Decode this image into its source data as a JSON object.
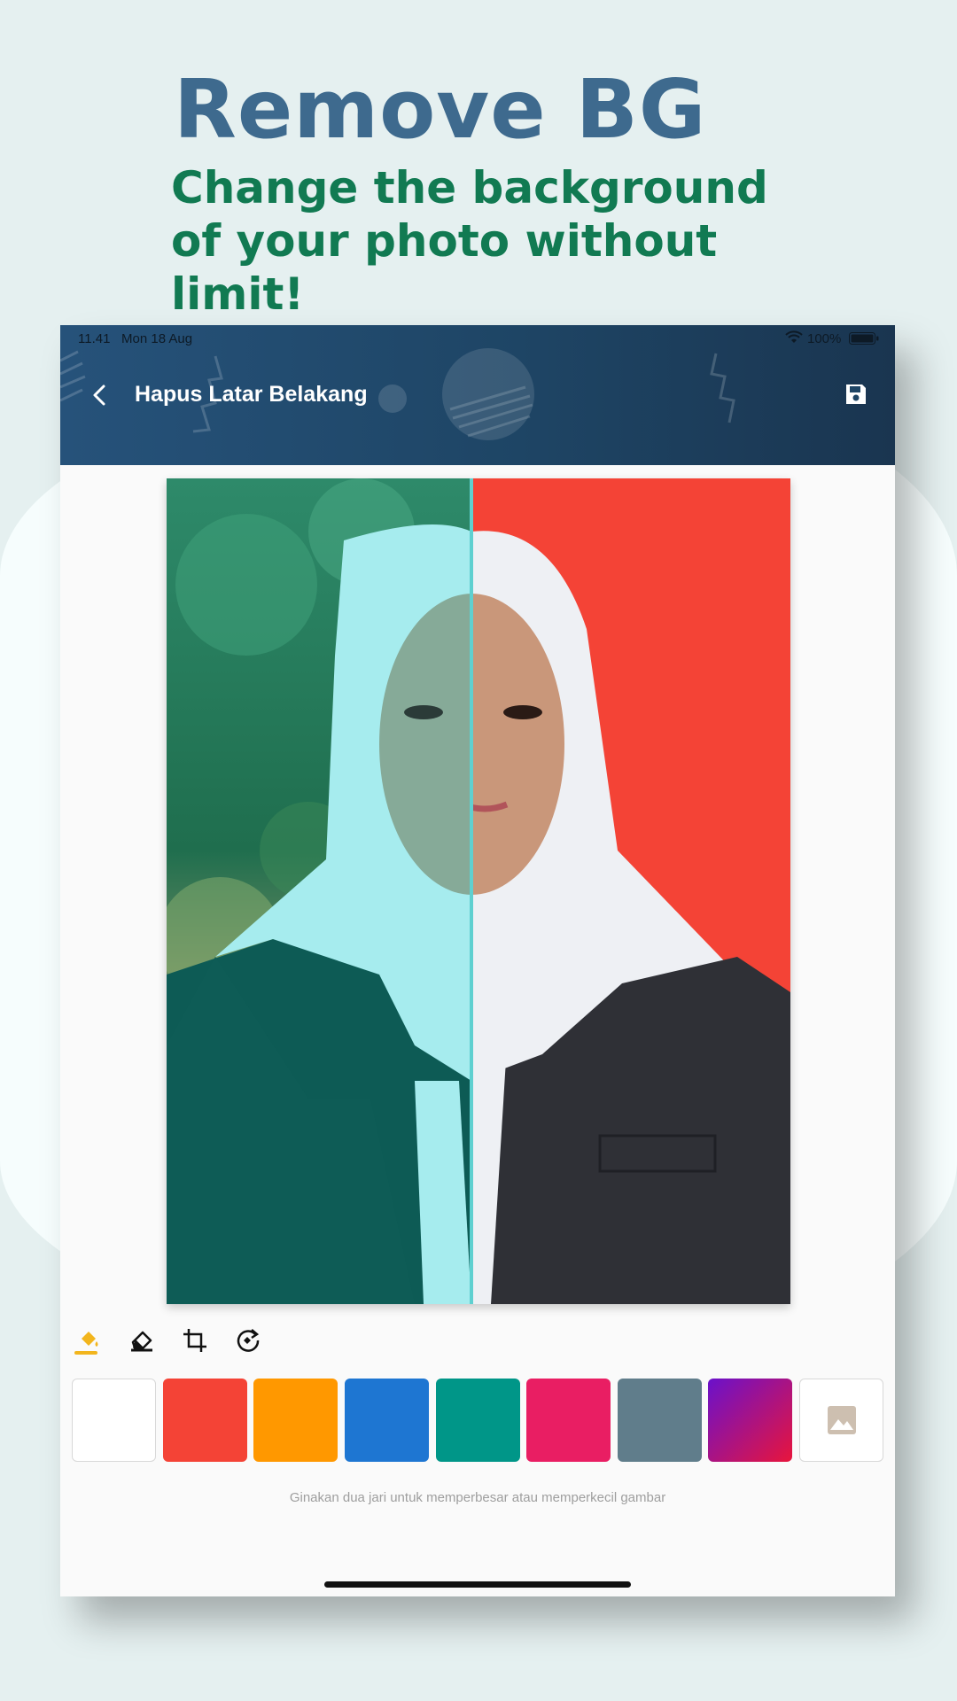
{
  "promo": {
    "title": "Remove BG",
    "subtitle": "Change the background of your photo without limit!"
  },
  "status_bar": {
    "time": "11.41",
    "date": "Mon 18 Aug",
    "battery": "100%",
    "icons": [
      "wifi-icon",
      "battery-icon"
    ]
  },
  "app_bar": {
    "title": "Hapus Latar Belakang",
    "back_icon": "chevron-left-icon",
    "save_icon": "save-icon"
  },
  "editor": {
    "compare_split": 0.49,
    "original_background": "blurred greenery",
    "new_background_color": "#F44336"
  },
  "tools": [
    {
      "name": "fill-bucket-icon",
      "active": true
    },
    {
      "name": "eraser-icon",
      "active": false
    },
    {
      "name": "crop-icon",
      "active": false
    },
    {
      "name": "rotate-icon",
      "active": false
    }
  ],
  "colors": {
    "accent": "#F2B51D",
    "app_bar": "#1E4565"
  },
  "swatches": [
    {
      "name": "white",
      "color": "#FFFFFF"
    },
    {
      "name": "red",
      "color": "#F44336"
    },
    {
      "name": "orange",
      "color": "#FF9800"
    },
    {
      "name": "blue",
      "color": "#1E76D2"
    },
    {
      "name": "teal",
      "color": "#009688"
    },
    {
      "name": "pink",
      "color": "#E91E63"
    },
    {
      "name": "blue-grey",
      "color": "#607D8B"
    },
    {
      "name": "gradient-purple-red",
      "color": "linear-gradient(135deg, #6a11cb 0%, #e8153c 100%)"
    },
    {
      "name": "image-picker",
      "icon": "image-icon"
    }
  ],
  "hint": "Ginakan dua jari untuk memperbesar atau memperkecil gambar"
}
